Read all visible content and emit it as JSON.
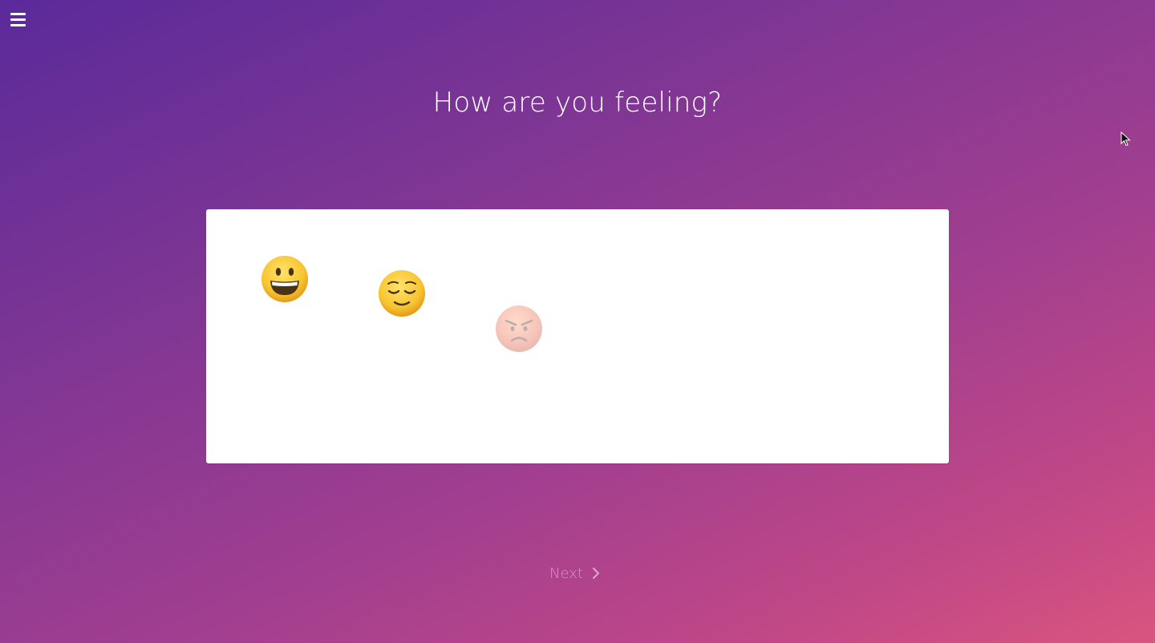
{
  "header": {
    "menu_icon": "hamburger-menu-icon"
  },
  "page": {
    "title": "How are you feeling?"
  },
  "moods": [
    {
      "name": "grinning",
      "icon": "grinning-face-emoji",
      "state": "active"
    },
    {
      "name": "relieved",
      "icon": "relieved-face-emoji",
      "state": "active"
    },
    {
      "name": "angry",
      "icon": "angry-face-emoji",
      "state": "faded"
    }
  ],
  "footer": {
    "next_label": "Next",
    "next_icon": "chevron-right-icon"
  },
  "colors": {
    "gradient_start": "#5a2a9a",
    "gradient_end": "#d9557f",
    "card_bg": "#ffffff",
    "emoji_yellow": "#f7c531"
  }
}
